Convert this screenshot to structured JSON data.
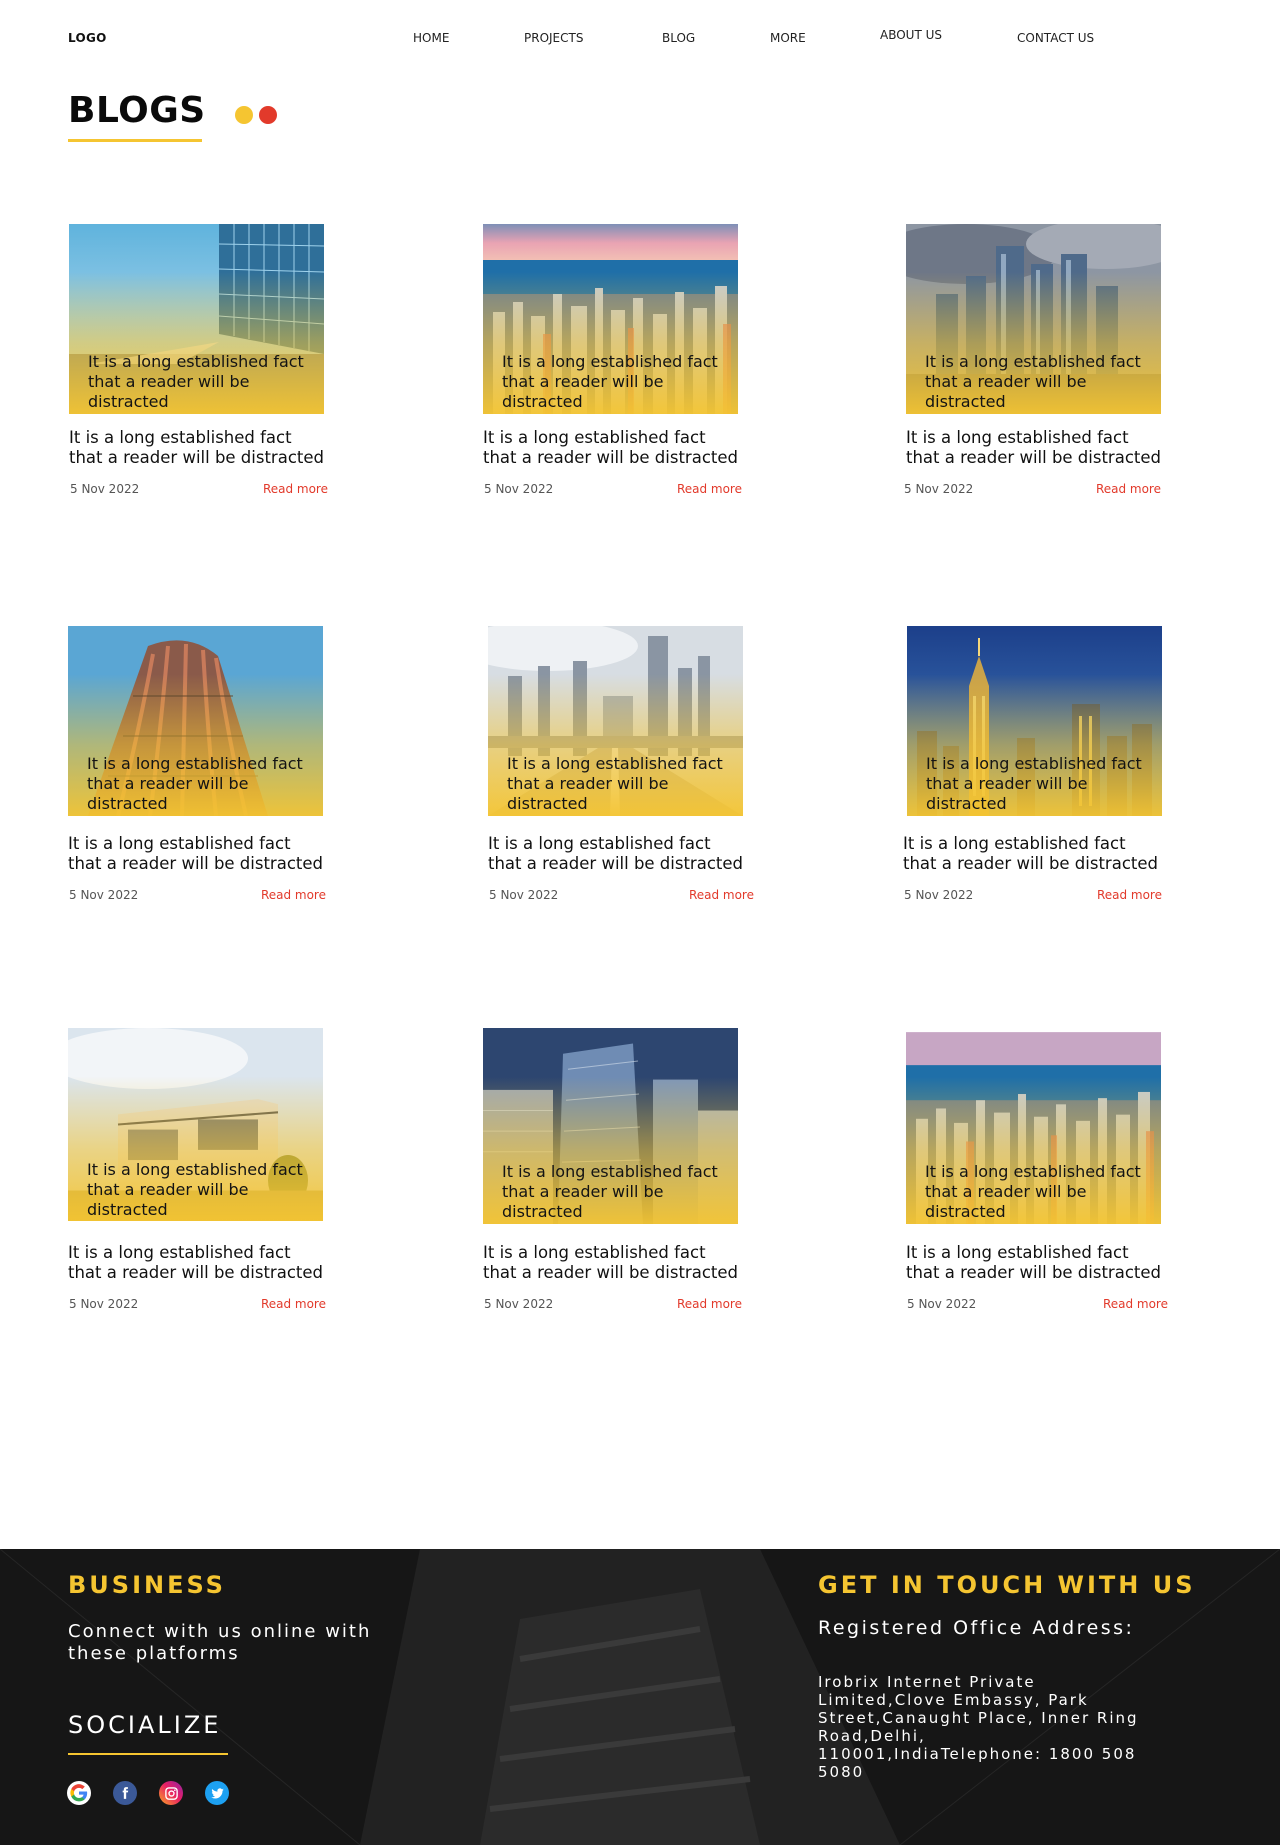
{
  "header": {
    "logo": "LOGO",
    "nav": [
      {
        "label": "HOME"
      },
      {
        "label": "PROJECTS"
      },
      {
        "label": "BLOG"
      },
      {
        "label": "MORE"
      },
      {
        "label": "ABOUT US"
      },
      {
        "label": "CONTACT US"
      }
    ]
  },
  "page": {
    "title": "BLOGS",
    "dot_colors": [
      "#f5c531",
      "#e23a2b"
    ]
  },
  "blogs": [
    {
      "overlay": "It is a long established fact that a reader will be distracted",
      "excerpt": "It is a long established fact that a reader will be distracted",
      "date": "5 Nov 2022",
      "read_more": "Read more"
    },
    {
      "overlay": "It is a long established fact that a reader will be distracted",
      "excerpt": "It is a long established fact that a reader will be distracted",
      "date": "5 Nov 2022",
      "read_more": "Read more"
    },
    {
      "overlay": "It is a long established fact that a reader will be distracted",
      "excerpt": "It is a long established fact that a reader will be distracted",
      "date": "5 Nov 2022",
      "read_more": "Read more"
    },
    {
      "overlay": "It is a long established fact that a reader will be distracted",
      "excerpt": "It is a long established fact that a reader will be distracted",
      "date": "5 Nov 2022",
      "read_more": "Read more"
    },
    {
      "overlay": "It is a long established fact that a reader will be distracted",
      "excerpt": "It is a long established fact that a reader will be distracted",
      "date": "5 Nov 2022",
      "read_more": "Read more"
    },
    {
      "overlay": "It is a long established fact that a reader will be distracted",
      "excerpt": "It is a long established fact that a reader will be distracted",
      "date": "5 Nov 2022",
      "read_more": "Read more"
    },
    {
      "overlay": "It is a long established fact that a reader will be distracted",
      "excerpt": "It is a long established fact that a reader will be distracted",
      "date": "5 Nov 2022",
      "read_more": "Read more"
    },
    {
      "overlay": "It is a long established fact that a reader will be distracted",
      "excerpt": "It is a long established fact that a reader will be distracted",
      "date": "5 Nov 2022",
      "read_more": "Read more"
    },
    {
      "overlay": "It is a long established fact that a reader will be distracted",
      "excerpt": "It is a long established fact that a reader will be distracted",
      "date": "5 Nov 2022",
      "read_more": "Read more"
    }
  ],
  "footer": {
    "business_heading": "BUSINESS",
    "connect_text": "Connect with us online with these platforms",
    "socialize_heading": "SOCIALIZE",
    "social_icons": [
      "google-icon",
      "facebook-icon",
      "instagram-icon",
      "twitter-icon"
    ],
    "contact_heading": "GET IN TOUCH WITH US",
    "office_heading": "Registered Office Address:",
    "address": "Irobrix Internet Private Limited,Clove Embassy, Park Street,Canaught Place, Inner Ring Road,Delhi, 110001,IndiaTelephone: 1800 508 5080"
  },
  "colors": {
    "accent": "#f5c531",
    "link": "#e23a2b",
    "footer_bg": "#161616"
  }
}
